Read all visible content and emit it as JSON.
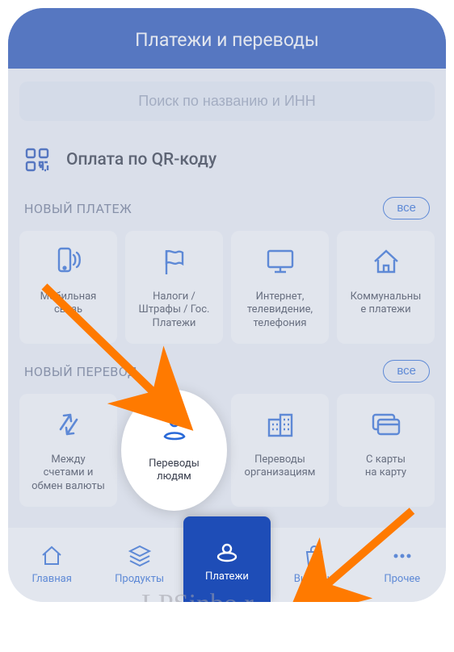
{
  "header": {
    "title": "Платежи и переводы"
  },
  "search": {
    "placeholder": "Поиск по названию и ИНН"
  },
  "qr": {
    "label": "Оплата по QR-коду"
  },
  "section_payment": {
    "title": "НОВЫЙ ПЛАТЕЖ",
    "chip": "все",
    "tiles": [
      {
        "label": "Мобильная\nсвязь"
      },
      {
        "label": "Налоги /\nШтрафы / Гос.\nПлатежи"
      },
      {
        "label": "Интернет,\nтелевидение,\nтелефония"
      },
      {
        "label": "Коммунальны\nе платежи"
      }
    ]
  },
  "section_transfer": {
    "title": "НОВЫЙ ПЕРЕВОД",
    "chip": "все",
    "tiles": [
      {
        "label": "Между\nсчетами и\nобмен валюты"
      },
      {
        "label": "Переводы\nлюдям"
      },
      {
        "label": "Переводы\nорганизациям"
      },
      {
        "label": "С карты\nна карту"
      }
    ]
  },
  "nav": {
    "items": [
      {
        "label": "Главная"
      },
      {
        "label": "Продукты"
      },
      {
        "label": "Платежи"
      },
      {
        "label": "Витрина"
      },
      {
        "label": "Прочее"
      }
    ]
  },
  "colors": {
    "accent": "#2a6ad8",
    "header": "#1e4db7"
  }
}
